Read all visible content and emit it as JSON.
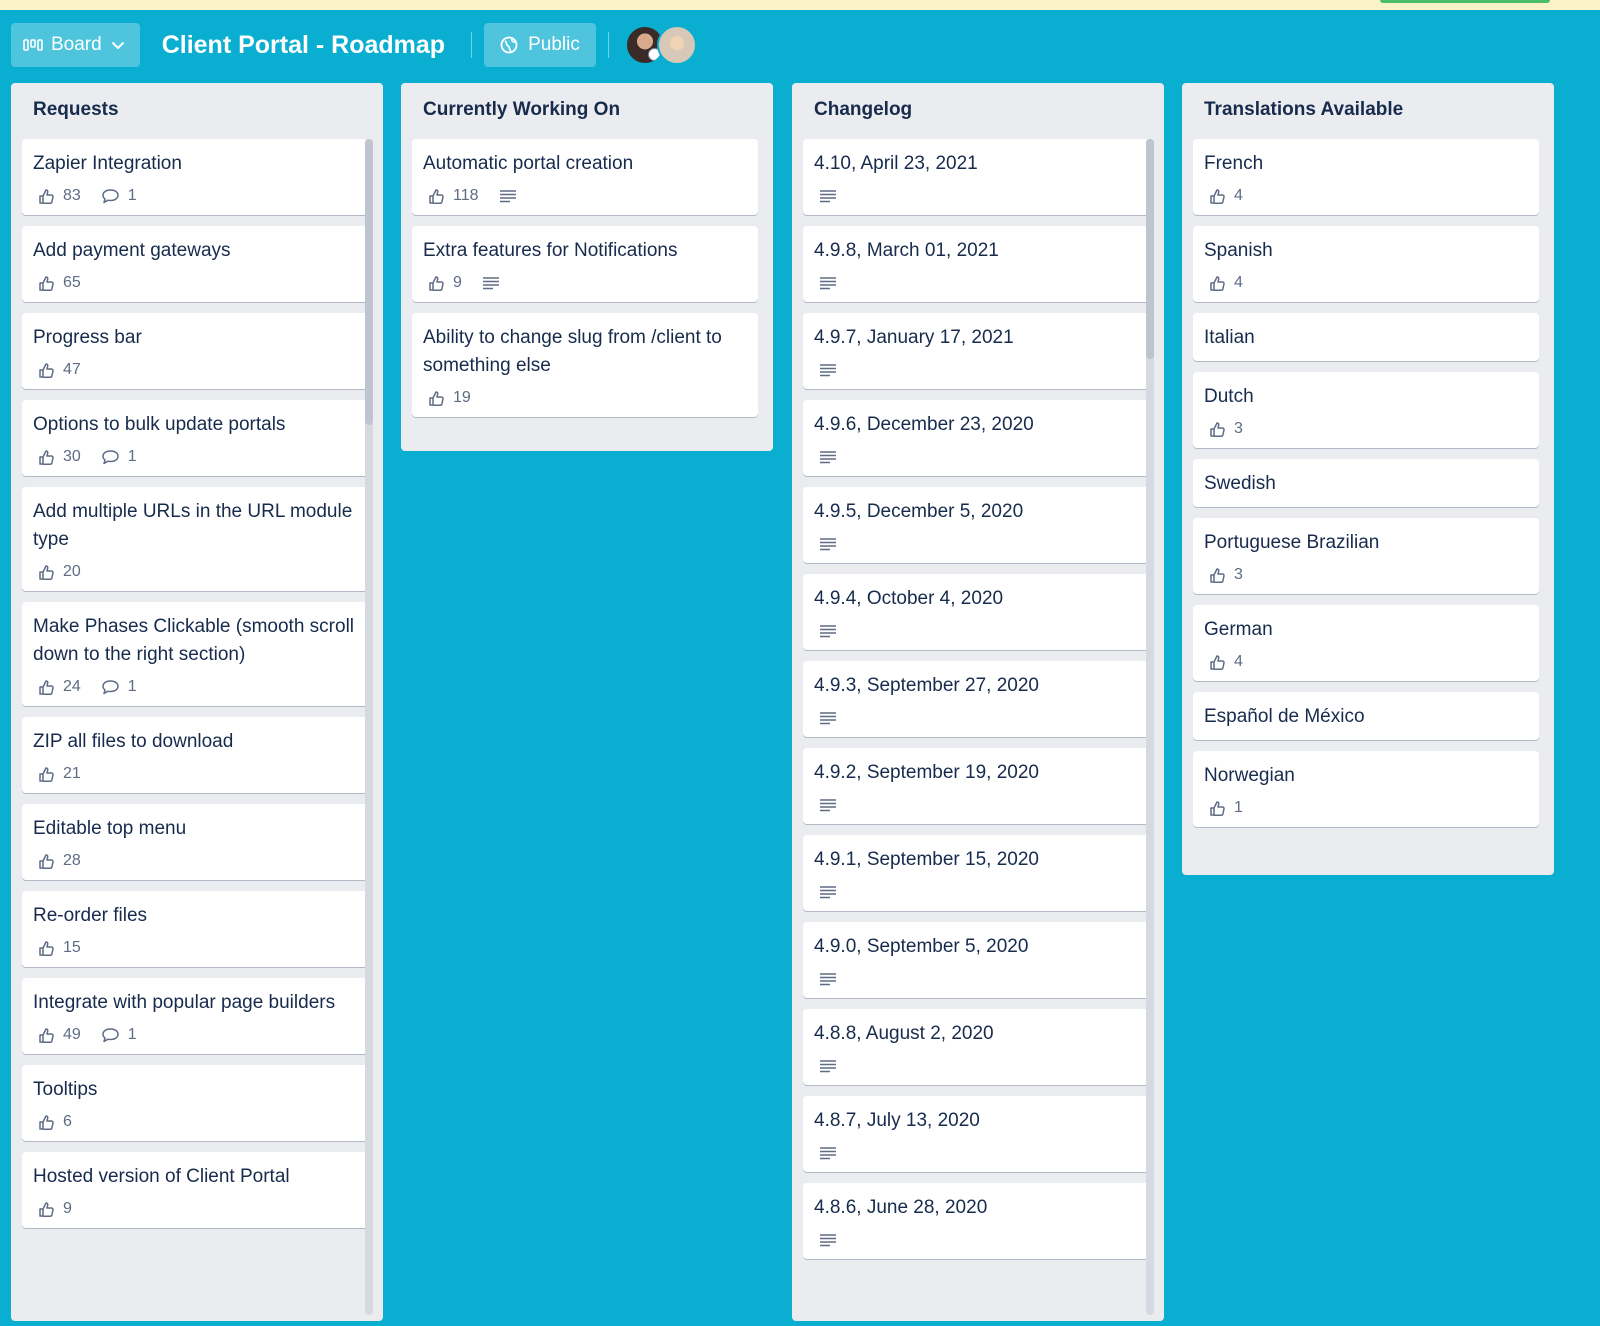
{
  "header": {
    "view_label": "Board",
    "board_title": "Client Portal - Roadmap",
    "visibility_label": "Public"
  },
  "lists": [
    {
      "title": "Requests",
      "cards": [
        {
          "title": "Zapier Integration",
          "votes": "83",
          "comments": "1",
          "description": false
        },
        {
          "title": "Add payment gateways",
          "votes": "65",
          "comments": null,
          "description": false
        },
        {
          "title": "Progress bar",
          "votes": "47",
          "comments": null,
          "description": false
        },
        {
          "title": "Options to bulk update portals",
          "votes": "30",
          "comments": "1",
          "description": false
        },
        {
          "title": "Add multiple URLs in the URL module type",
          "votes": "20",
          "comments": null,
          "description": false
        },
        {
          "title": "Make Phases Clickable (smooth scroll down to the right section)",
          "votes": "24",
          "comments": "1",
          "description": false
        },
        {
          "title": "ZIP all files to download",
          "votes": "21",
          "comments": null,
          "description": false
        },
        {
          "title": "Editable top menu",
          "votes": "28",
          "comments": null,
          "description": false
        },
        {
          "title": "Re-order files",
          "votes": "15",
          "comments": null,
          "description": false
        },
        {
          "title": "Integrate with popular page builders",
          "votes": "49",
          "comments": "1",
          "description": false
        },
        {
          "title": "Tooltips",
          "votes": "6",
          "comments": null,
          "description": false
        },
        {
          "title": "Hosted version of Client Portal",
          "votes": "9",
          "comments": null,
          "description": false
        }
      ]
    },
    {
      "title": "Currently Working On",
      "cards": [
        {
          "title": "Automatic portal creation",
          "votes": "118",
          "comments": null,
          "description": true
        },
        {
          "title": "Extra features for Notifications",
          "votes": "9",
          "comments": null,
          "description": true
        },
        {
          "title": "Ability to change slug from /client to something else",
          "votes": "19",
          "comments": null,
          "description": false
        }
      ]
    },
    {
      "title": "Changelog",
      "cards": [
        {
          "title": "4.10, April 23, 2021",
          "votes": null,
          "comments": null,
          "description": true
        },
        {
          "title": "4.9.8, March 01, 2021",
          "votes": null,
          "comments": null,
          "description": true
        },
        {
          "title": "4.9.7, January 17, 2021",
          "votes": null,
          "comments": null,
          "description": true
        },
        {
          "title": "4.9.6, December 23, 2020",
          "votes": null,
          "comments": null,
          "description": true
        },
        {
          "title": "4.9.5, December 5, 2020",
          "votes": null,
          "comments": null,
          "description": true
        },
        {
          "title": "4.9.4, October 4, 2020",
          "votes": null,
          "comments": null,
          "description": true
        },
        {
          "title": "4.9.3, September 27, 2020",
          "votes": null,
          "comments": null,
          "description": true
        },
        {
          "title": "4.9.2, September 19, 2020",
          "votes": null,
          "comments": null,
          "description": true
        },
        {
          "title": "4.9.1, September 15, 2020",
          "votes": null,
          "comments": null,
          "description": true
        },
        {
          "title": "4.9.0, September 5, 2020",
          "votes": null,
          "comments": null,
          "description": true
        },
        {
          "title": "4.8.8, August 2, 2020",
          "votes": null,
          "comments": null,
          "description": true
        },
        {
          "title": "4.8.7, July 13, 2020",
          "votes": null,
          "comments": null,
          "description": true
        },
        {
          "title": "4.8.6, June 28, 2020",
          "votes": null,
          "comments": null,
          "description": true
        }
      ]
    },
    {
      "title": "Translations Available",
      "cards": [
        {
          "title": "French",
          "votes": "4",
          "comments": null,
          "description": false
        },
        {
          "title": "Spanish",
          "votes": "4",
          "comments": null,
          "description": false
        },
        {
          "title": "Italian",
          "votes": null,
          "comments": null,
          "description": false
        },
        {
          "title": "Dutch",
          "votes": "3",
          "comments": null,
          "description": false
        },
        {
          "title": "Swedish",
          "votes": null,
          "comments": null,
          "description": false
        },
        {
          "title": "Portuguese Brazilian",
          "votes": "3",
          "comments": null,
          "description": false
        },
        {
          "title": "German",
          "votes": "4",
          "comments": null,
          "description": false
        },
        {
          "title": "Español de México",
          "votes": null,
          "comments": null,
          "description": false
        },
        {
          "title": "Norwegian",
          "votes": "1",
          "comments": null,
          "description": false
        }
      ]
    }
  ],
  "colors": {
    "board_background": "#0aaed0",
    "list_background": "#ebecf0",
    "card_background": "#ffffff",
    "text_primary": "#172b4d",
    "text_secondary": "#5e6c84"
  }
}
